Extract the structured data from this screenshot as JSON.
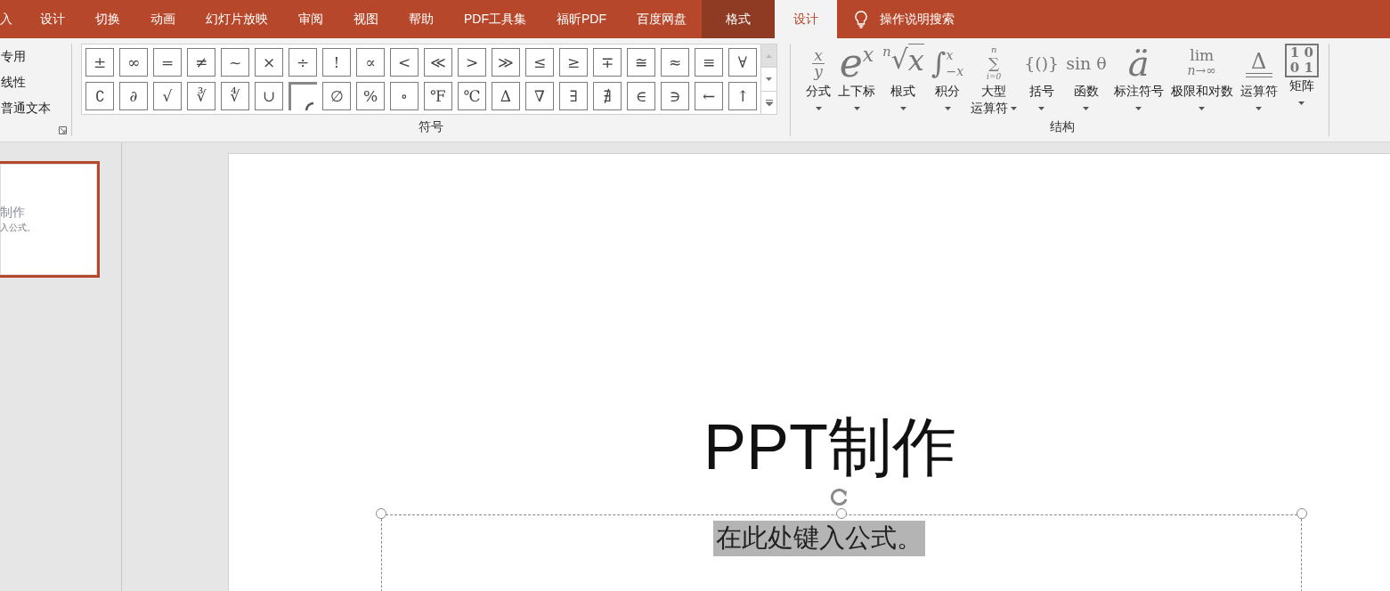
{
  "ribbon_tabs": [
    {
      "label": "入",
      "selected": false,
      "contextual": false
    },
    {
      "label": "设计",
      "selected": false,
      "contextual": false
    },
    {
      "label": "切换",
      "selected": false,
      "contextual": false
    },
    {
      "label": "动画",
      "selected": false,
      "contextual": false
    },
    {
      "label": "幻灯片放映",
      "selected": false,
      "contextual": false
    },
    {
      "label": "审阅",
      "selected": false,
      "contextual": false
    },
    {
      "label": "视图",
      "selected": false,
      "contextual": false
    },
    {
      "label": "帮助",
      "selected": false,
      "contextual": false
    },
    {
      "label": "PDF工具集",
      "selected": false,
      "contextual": false
    },
    {
      "label": "福昕PDF",
      "selected": false,
      "contextual": false
    },
    {
      "label": "百度网盘",
      "selected": false,
      "contextual": false
    },
    {
      "label": "格式",
      "selected": false,
      "contextual": true
    },
    {
      "label": "设计",
      "selected": true,
      "contextual": false
    }
  ],
  "tell_me": {
    "placeholder": "操作说明搜索"
  },
  "conversions": {
    "items": [
      "专用",
      "线性",
      "普通文本"
    ]
  },
  "symbols": {
    "label": "符号",
    "items": [
      {
        "kind": "glyph",
        "text": "±"
      },
      {
        "kind": "glyph",
        "text": "∞"
      },
      {
        "kind": "glyph",
        "text": "="
      },
      {
        "kind": "glyph",
        "text": "≠"
      },
      {
        "kind": "glyph",
        "text": "~"
      },
      {
        "kind": "glyph",
        "text": "×"
      },
      {
        "kind": "glyph",
        "text": "÷"
      },
      {
        "kind": "glyph",
        "text": "!"
      },
      {
        "kind": "glyph",
        "text": "∝"
      },
      {
        "kind": "glyph",
        "text": "<"
      },
      {
        "kind": "glyph",
        "text": "≪"
      },
      {
        "kind": "glyph",
        "text": ">"
      },
      {
        "kind": "glyph",
        "text": "≫"
      },
      {
        "kind": "glyph",
        "text": "≤"
      },
      {
        "kind": "glyph",
        "text": "≥"
      },
      {
        "kind": "glyph",
        "text": "∓"
      },
      {
        "kind": "glyph",
        "text": "≅"
      },
      {
        "kind": "glyph",
        "text": "≈"
      },
      {
        "kind": "glyph",
        "text": "≡"
      },
      {
        "kind": "glyph",
        "text": "∀"
      },
      {
        "kind": "glyph",
        "text": "∁"
      },
      {
        "kind": "glyph",
        "text": "∂"
      },
      {
        "kind": "glyph",
        "text": "√"
      },
      {
        "kind": "glyph",
        "text": "∛"
      },
      {
        "kind": "glyph",
        "text": "∜"
      },
      {
        "kind": "glyph",
        "text": "∪"
      },
      {
        "kind": "broken"
      },
      {
        "kind": "glyph",
        "text": "∅"
      },
      {
        "kind": "glyph",
        "text": "%"
      },
      {
        "kind": "glyph",
        "text": "∘"
      },
      {
        "kind": "glyph",
        "text": "℉"
      },
      {
        "kind": "glyph",
        "text": "℃"
      },
      {
        "kind": "glyph",
        "text": "∆"
      },
      {
        "kind": "glyph",
        "text": "∇"
      },
      {
        "kind": "glyph",
        "text": "∃"
      },
      {
        "kind": "glyph",
        "text": "∄"
      },
      {
        "kind": "glyph",
        "text": "∈"
      },
      {
        "kind": "glyph",
        "text": "∋"
      },
      {
        "kind": "glyph",
        "text": "←"
      },
      {
        "kind": "glyph",
        "text": "↑"
      }
    ]
  },
  "structures": {
    "label": "结构",
    "items": [
      {
        "kind": "fraction",
        "parts": [
          "x",
          "y"
        ],
        "label": [
          "分式"
        ]
      },
      {
        "kind": "script",
        "parts": [
          "e",
          "x"
        ],
        "label": [
          "上下标"
        ]
      },
      {
        "kind": "radical",
        "parts": [
          "n",
          "√",
          "x"
        ],
        "label": [
          "根式"
        ]
      },
      {
        "kind": "integral",
        "parts": [
          "∫",
          "x",
          "−x"
        ],
        "label": [
          "积分"
        ]
      },
      {
        "kind": "bigop",
        "parts": [
          "n",
          "∑",
          "i=0"
        ],
        "label": [
          "大型",
          "运算符"
        ]
      },
      {
        "kind": "plain",
        "parts": [
          "{()}"
        ],
        "label": [
          "括号"
        ]
      },
      {
        "kind": "plain",
        "parts": [
          "sin θ"
        ],
        "label": [
          "函数"
        ]
      },
      {
        "kind": "accent",
        "parts": [
          "ä"
        ],
        "label": [
          "标注符号"
        ]
      },
      {
        "kind": "limit",
        "parts": [
          "lim",
          "n→∞"
        ],
        "label": [
          "极限和对数"
        ]
      },
      {
        "kind": "operator",
        "parts": [
          "Δ"
        ],
        "label": [
          "运算符"
        ]
      },
      {
        "kind": "matrix",
        "parts": [
          "1 0",
          "0 1"
        ],
        "label": [
          "矩阵"
        ]
      }
    ]
  },
  "thumbnail": {
    "title": "制作",
    "subtitle": "入公式。",
    "selected": true
  },
  "slide": {
    "title": "PPT制作",
    "equation": {
      "placeholder": "在此处键入公式。"
    }
  }
}
